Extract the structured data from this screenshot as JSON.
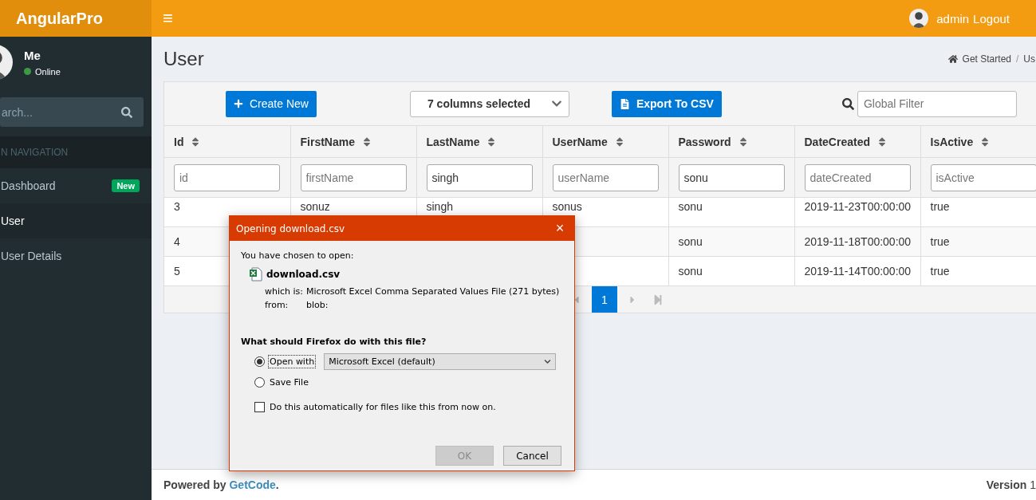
{
  "header": {
    "logo": "AngularPro",
    "menu_toggle": "≡",
    "user_name": "admin",
    "logout": "Logout"
  },
  "sidebar": {
    "user": {
      "name": "Me",
      "status": "Online"
    },
    "search": {
      "placeholder": "arch..."
    },
    "section": "N NAVIGATION",
    "items": [
      {
        "label": "Dashboard",
        "badge": "New",
        "selected": false
      },
      {
        "label": "User",
        "selected": true
      },
      {
        "label": "User Details",
        "selected": false
      }
    ]
  },
  "page": {
    "title": "User",
    "breadcrumb": [
      "Get Started",
      "Us"
    ],
    "breadcrumb_separator": "/"
  },
  "toolbar": {
    "create": "Create New",
    "columns": "7 columns selected",
    "export": "Export To CSV",
    "filter": {
      "placeholder": "Global Filter"
    }
  },
  "table": {
    "columns": [
      "Id",
      "FirstName",
      "LastName",
      "UserName",
      "Password",
      "DateCreated",
      "IsActive"
    ],
    "filters": [
      {
        "placeholder": "id"
      },
      {
        "placeholder": "firstName"
      },
      {
        "value": "singh"
      },
      {
        "placeholder": "userName"
      },
      {
        "value": "sonu"
      },
      {
        "placeholder": "dateCreated"
      },
      {
        "placeholder": "isActive"
      }
    ],
    "rows": [
      [
        "3",
        "sonuz",
        "singh",
        "sonus",
        "sonu",
        "2019-11-23T00:00:00",
        "true"
      ],
      [
        "4",
        null,
        null,
        null,
        "sonu",
        "2019-11-18T00:00:00",
        "true"
      ],
      [
        "5",
        null,
        null,
        null,
        "sonu",
        "2019-11-14T00:00:00",
        "true"
      ]
    ],
    "pages": [
      {
        "label": "1",
        "selected": true
      }
    ]
  },
  "dialog": {
    "title": "Opening download.csv",
    "close": "×",
    "intro": "You have chosen to open:",
    "file": "download.csv",
    "type_label": "which is:",
    "type": "Microsoft Excel Comma Separated Values File (271 bytes)",
    "from_label": "from:",
    "from": "blob:",
    "question": "What should Firefox do with this file?",
    "options": [
      {
        "label": "Open with",
        "selected": true,
        "app": "Microsoft Excel (default)"
      },
      {
        "label": "Save File",
        "selected": false
      }
    ],
    "auto": {
      "label": "Do this automatically for files like this from now on.",
      "checked": false
    },
    "buttons": [
      {
        "label": "OK",
        "disabled": true
      },
      {
        "label": "Cancel",
        "disabled": false
      }
    ]
  },
  "footer": {
    "text": "Powered by",
    "link": "GetCode",
    "after": ".",
    "version_label": "Version",
    "version": "1"
  }
}
